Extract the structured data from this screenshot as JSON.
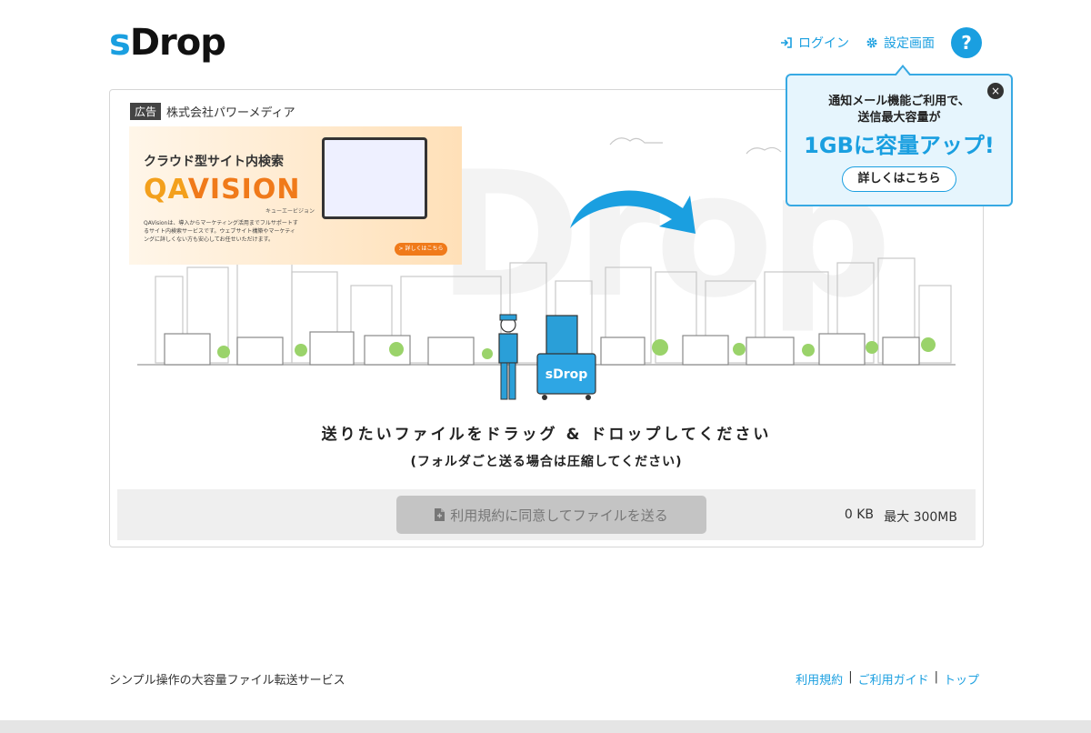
{
  "header": {
    "logo_s": "s",
    "logo_rest": "Drop",
    "login_label": "ログイン",
    "settings_label": "設定画面",
    "help_label": "?"
  },
  "popup": {
    "line1": "通知メール機能ご利用で、",
    "line2": "送信最大容量が",
    "highlight": "1GBに容量アップ!",
    "button": "詳しくはこちら",
    "close": "×"
  },
  "ad": {
    "tag": "広告",
    "sponsor": "株式会社パワーメディア",
    "headline": "クラウド型サイト内検索",
    "brand_a": "QA",
    "brand_b": "VISION",
    "brand_sub": "キューエービジョン",
    "desc": "QAVisionは、導入からマーケティング活用までフルサポートするサイト内検索サービスです。ウェブサイト構築やマーケティングに詳しくない方も安心してお任せいただけます。",
    "cta": "> 詳しくはこちら"
  },
  "dropzone": {
    "watermark": "Drop",
    "cart_label": "sDrop",
    "message": "送りたいファイルをドラッグ & ドロップしてください",
    "sub_message": "(フォルダごと送る場合は圧縮してください)"
  },
  "send": {
    "button_label": "利用規約に同意してファイルを送る",
    "size": "0 KB",
    "max": "最大 300MB"
  },
  "footer": {
    "tagline": "シンプル操作の大容量ファイル転送サービス",
    "link_terms": "利用規約",
    "link_guide": "ご利用ガイド",
    "link_top": "トップ",
    "sep": "|"
  },
  "colors": {
    "accent": "#1a9fe0",
    "button_disabled": "#c4c4c4"
  }
}
